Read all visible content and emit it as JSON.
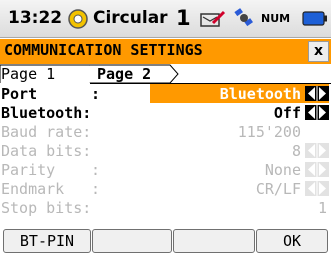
{
  "status_bar": {
    "time": "13:22",
    "mode": "Circular",
    "count": "1",
    "num_indicator": "NUM",
    "icons": [
      "circular-mode-icon",
      "edit-icon",
      "satellite-icon",
      "battery-icon"
    ]
  },
  "window": {
    "title": "COMMUNICATION SETTINGS",
    "close_label": "x",
    "accent_color": "#ff9900"
  },
  "tabs": [
    {
      "label": "Page 1",
      "active": true
    },
    {
      "label": "Page 2",
      "active": false
    }
  ],
  "fields": [
    {
      "label": "Port",
      "sep": ":",
      "value": "Bluetooth",
      "state": "selected",
      "has_arrows": true
    },
    {
      "label": "Bluetooth",
      "sep": ":",
      "value": "Off",
      "state": "active",
      "has_arrows": true
    },
    {
      "label": "Baud rate",
      "sep": ":",
      "value": "115'200",
      "state": "disabled",
      "has_arrows": true
    },
    {
      "label": "Data bits",
      "sep": ":",
      "value": "8",
      "state": "disabled",
      "has_arrows": true
    },
    {
      "label": "Parity",
      "sep": ":",
      "value": "None",
      "state": "disabled",
      "has_arrows": true
    },
    {
      "label": "Endmark",
      "sep": ":",
      "value": "CR/LF",
      "state": "disabled",
      "has_arrows": true
    },
    {
      "label": "Stop bits",
      "sep": ":",
      "value": "1",
      "state": "disabled",
      "has_arrows": false
    }
  ],
  "softkeys": [
    "BT-PIN",
    "",
    "",
    "OK"
  ]
}
